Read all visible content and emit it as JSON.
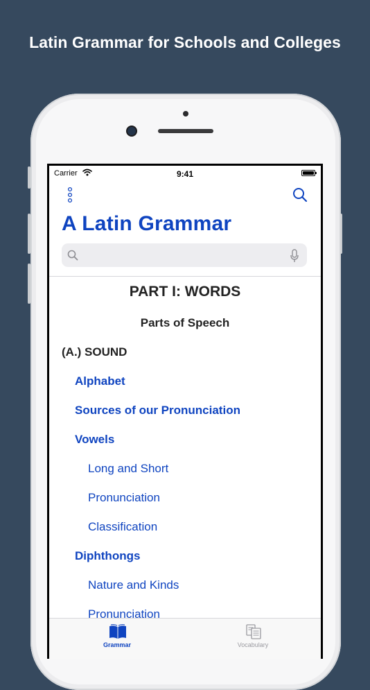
{
  "promo": {
    "headline": "Latin Grammar for Schools and Colleges"
  },
  "status_bar": {
    "carrier": "Carrier",
    "time": "9:41"
  },
  "nav": {
    "title": "A Latin Grammar",
    "menu_icon": "more-vertical-icon",
    "search_icon": "search-icon"
  },
  "search": {
    "value": "",
    "placeholder": "",
    "mic_icon": "microphone-icon"
  },
  "content": {
    "part_title": "PART I: WORDS",
    "subtitle": "Parts of Speech",
    "section": "(A.) SOUND",
    "entries": [
      {
        "label": "Alphabet",
        "level": 1
      },
      {
        "label": "Sources of our Pronunciation",
        "level": 1
      },
      {
        "label": "Vowels",
        "level": 1
      },
      {
        "label": "Long and Short",
        "level": 2
      },
      {
        "label": "Pronunciation",
        "level": 2
      },
      {
        "label": "Classification",
        "level": 2
      },
      {
        "label": "Diphthongs",
        "level": 1
      },
      {
        "label": "Nature and Kinds",
        "level": 2
      },
      {
        "label": "Pronunciation",
        "level": 2
      }
    ]
  },
  "tabbar": {
    "tabs": [
      {
        "label": "Grammar",
        "icon": "book-icon",
        "selected": true
      },
      {
        "label": "Vocabulary",
        "icon": "cards-icon",
        "selected": false
      }
    ]
  },
  "colors": {
    "accent": "#0f44c0",
    "background": "#36495e"
  }
}
